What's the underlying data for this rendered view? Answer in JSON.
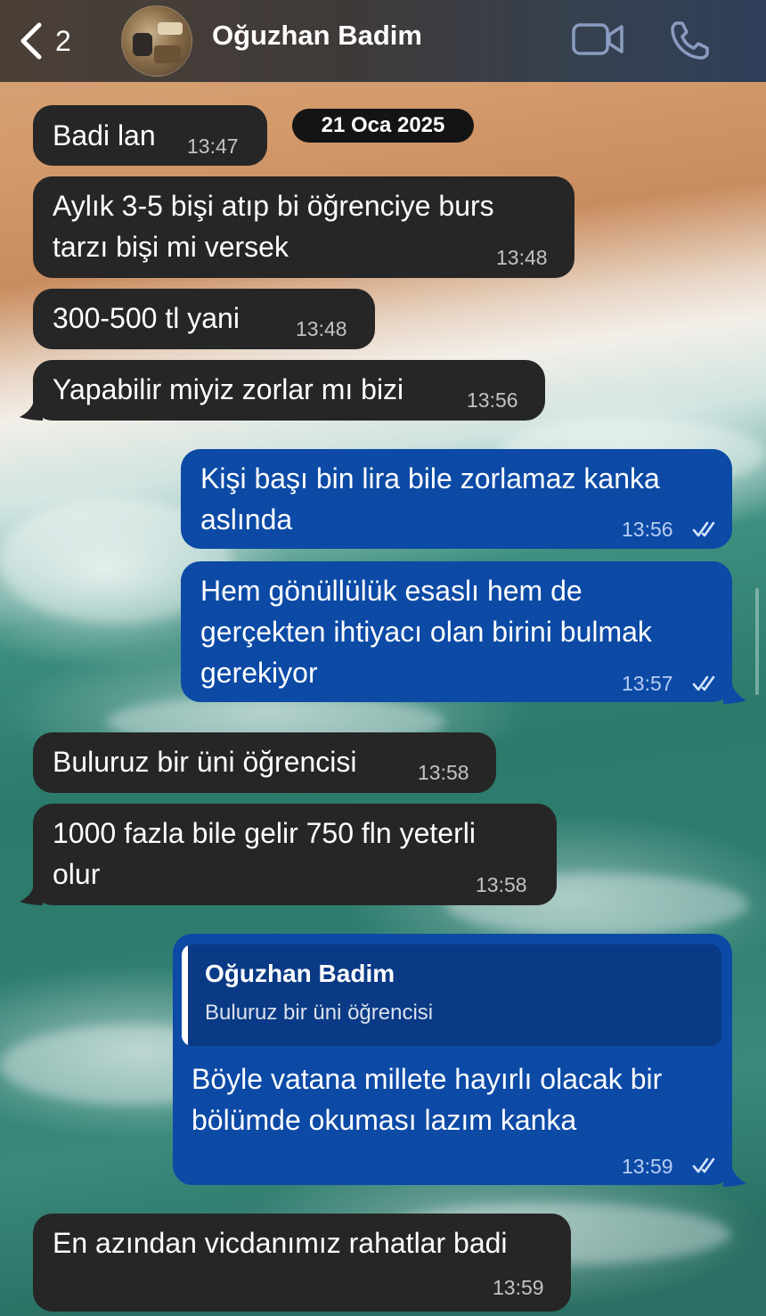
{
  "header": {
    "back_count": "2",
    "contact_name": "Oğuzhan Badim"
  },
  "date_pill": "21 Oca 2025",
  "messages": [
    {
      "dir": "in",
      "text": "Badi lan",
      "time": "13:47"
    },
    {
      "dir": "in",
      "text": "Aylık 3-5 bişi atıp bi öğrenciye burs\ntarzı bişi mi versek",
      "time": "13:48"
    },
    {
      "dir": "in",
      "text": "300-500 tl yani",
      "time": "13:48"
    },
    {
      "dir": "in",
      "text": "Yapabilir miyiz zorlar mı bizi",
      "time": "13:56"
    },
    {
      "dir": "out",
      "text": "Kişi başı bin lira bile zorlamaz kanka\naslında",
      "time": "13:56",
      "status": "read"
    },
    {
      "dir": "out",
      "text": "Hem gönüllülük esaslı hem de\ngerçekten ihtiyacı olan birini bulmak\ngerekiyor",
      "time": "13:57",
      "status": "read"
    },
    {
      "dir": "in",
      "text": "Buluruz bir üni öğrencisi",
      "time": "13:58"
    },
    {
      "dir": "in",
      "text": "1000 fazla bile gelir 750 fln yeterli\nolur",
      "time": "13:58"
    },
    {
      "dir": "out",
      "reply_to": {
        "name": "Oğuzhan Badim",
        "text": "Buluruz bir üni öğrencisi"
      },
      "text": "Böyle vatana millete hayırlı olacak bir\nbölümde okuması lazım kanka",
      "time": "13:59",
      "status": "read"
    },
    {
      "dir": "in",
      "text": "En azından vicdanımız rahatlar badi",
      "time": "13:59"
    }
  ],
  "colors": {
    "incoming_bubble": "#262626",
    "outgoing_bubble": "#0c4aa6",
    "quote_background": "#0a3a85",
    "date_pill": "#141414"
  },
  "icons": {
    "back": "chevron-left-icon",
    "video": "video-camera-icon",
    "phone": "phone-icon",
    "read_status": "double-check-icon"
  }
}
